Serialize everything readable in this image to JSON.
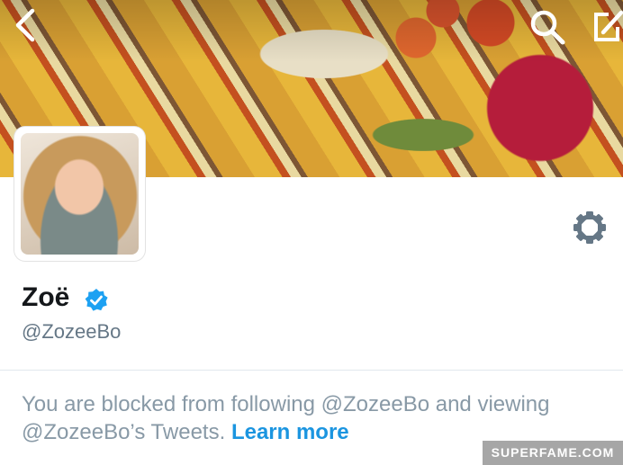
{
  "nav": {
    "back_icon": "chevron-left-icon",
    "search_icon": "search-icon",
    "compose_icon": "compose-icon"
  },
  "profile": {
    "display_name": "Zoë",
    "handle": "@ZozeeBo",
    "verified_icon": "verified-badge-icon",
    "settings_icon": "gear-icon"
  },
  "blocked_notice": {
    "text": "You are blocked from following @ZozeeBo and viewing @ZozeeBo’s Tweets.",
    "link_label": "Learn more"
  },
  "watermark": {
    "text": "SUPERFAME.COM"
  },
  "colors": {
    "verified": "#1da1f2",
    "link": "#1b95e0",
    "muted_text": "#8899a6",
    "name_text": "#14171a"
  }
}
